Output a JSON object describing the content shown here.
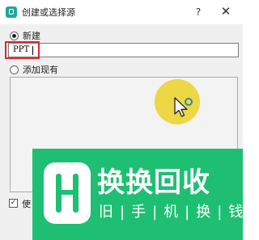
{
  "window": {
    "title": "创建或选择源",
    "help_label": "?",
    "close_label": "✕"
  },
  "options": {
    "create_new_label": "新建",
    "create_new_selected": true,
    "add_existing_label": "添加现有",
    "add_existing_selected": false
  },
  "name_input": {
    "value": "PPT"
  },
  "visibility_checkbox": {
    "label": "使",
    "checked": true,
    "check_mark": "✓"
  },
  "watermark": {
    "title": "换换回收",
    "subtitle": "旧|手|机|换|钱",
    "color": "#1fbf73"
  },
  "colors": {
    "highlight_box": "#e0282e",
    "cursor_circle": "#ecd53a",
    "app_icon": "#1fa89a"
  },
  "icons": {
    "app": "source-app-icon",
    "cursor": "mouse-pointer-icon"
  }
}
